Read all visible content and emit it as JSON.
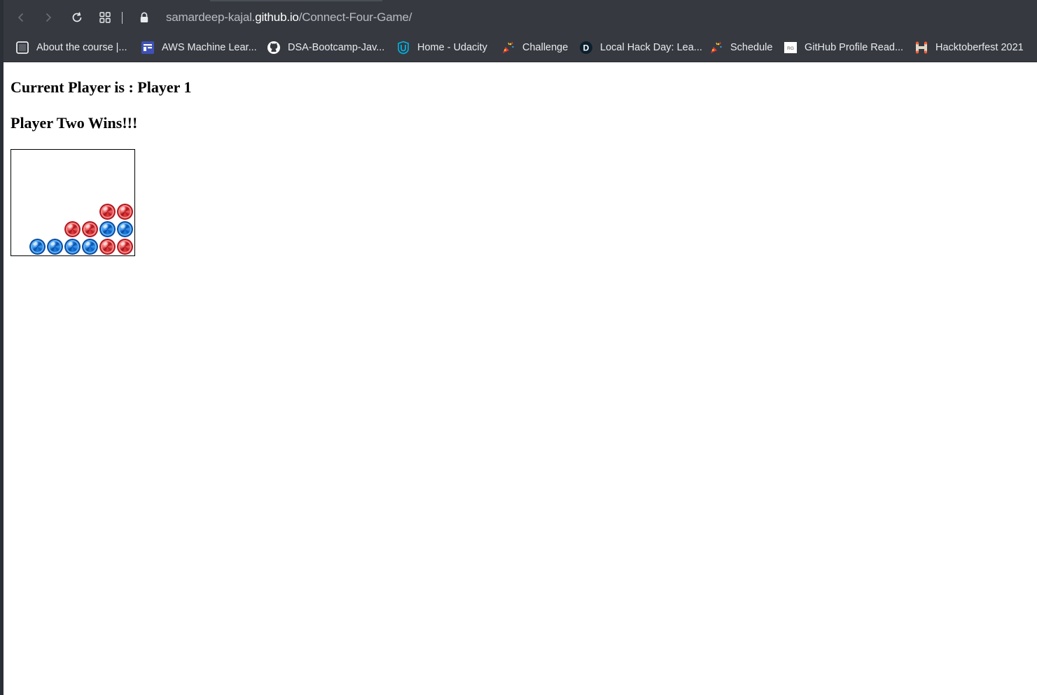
{
  "browser": {
    "url_prefix": "samardeep-kajal.",
    "url_host": "github.io",
    "url_path": "/Connect-Four-Game/",
    "nav": {
      "back_icon": "chevron-left-icon",
      "forward_icon": "chevron-right-icon",
      "reload_icon": "reload-icon",
      "apps_icon": "apps-grid-icon",
      "lock_icon": "lock-icon"
    }
  },
  "bookmarks": [
    {
      "label": "About the course |...",
      "icon": "page-icon"
    },
    {
      "label": "AWS Machine Lear...",
      "icon": "aws-course-icon"
    },
    {
      "label": "DSA-Bootcamp-Jav...",
      "icon": "github-icon"
    },
    {
      "label": "Home - Udacity",
      "icon": "udacity-icon"
    },
    {
      "label": "Challenge",
      "icon": "confetti-icon"
    },
    {
      "label": "Local Hack Day: Lea...",
      "icon": "dev-d-icon"
    },
    {
      "label": "Schedule",
      "icon": "confetti-icon"
    },
    {
      "label": "GitHub Profile Read...",
      "icon": "rg-icon"
    },
    {
      "label": "Hacktoberfest 2021",
      "icon": "hacktoberfest-icon"
    }
  ],
  "game": {
    "current_player_text": "Current Player is : Player 1",
    "result_text": "Player Two Wins!!!",
    "columns": 7,
    "rows": 6,
    "colors": {
      "player1": "#e23a3a",
      "player2": "#1f7fe0",
      "board_border": "#000000"
    },
    "discs": [
      {
        "row": 0,
        "col": 1,
        "player": "player2"
      },
      {
        "row": 0,
        "col": 2,
        "player": "player2"
      },
      {
        "row": 0,
        "col": 3,
        "player": "player2"
      },
      {
        "row": 0,
        "col": 4,
        "player": "player2"
      },
      {
        "row": 0,
        "col": 5,
        "player": "player1"
      },
      {
        "row": 0,
        "col": 6,
        "player": "player1"
      },
      {
        "row": 1,
        "col": 3,
        "player": "player1"
      },
      {
        "row": 1,
        "col": 4,
        "player": "player1"
      },
      {
        "row": 1,
        "col": 5,
        "player": "player2"
      },
      {
        "row": 1,
        "col": 6,
        "player": "player2"
      },
      {
        "row": 2,
        "col": 5,
        "player": "player1"
      },
      {
        "row": 2,
        "col": 6,
        "player": "player1"
      }
    ]
  }
}
